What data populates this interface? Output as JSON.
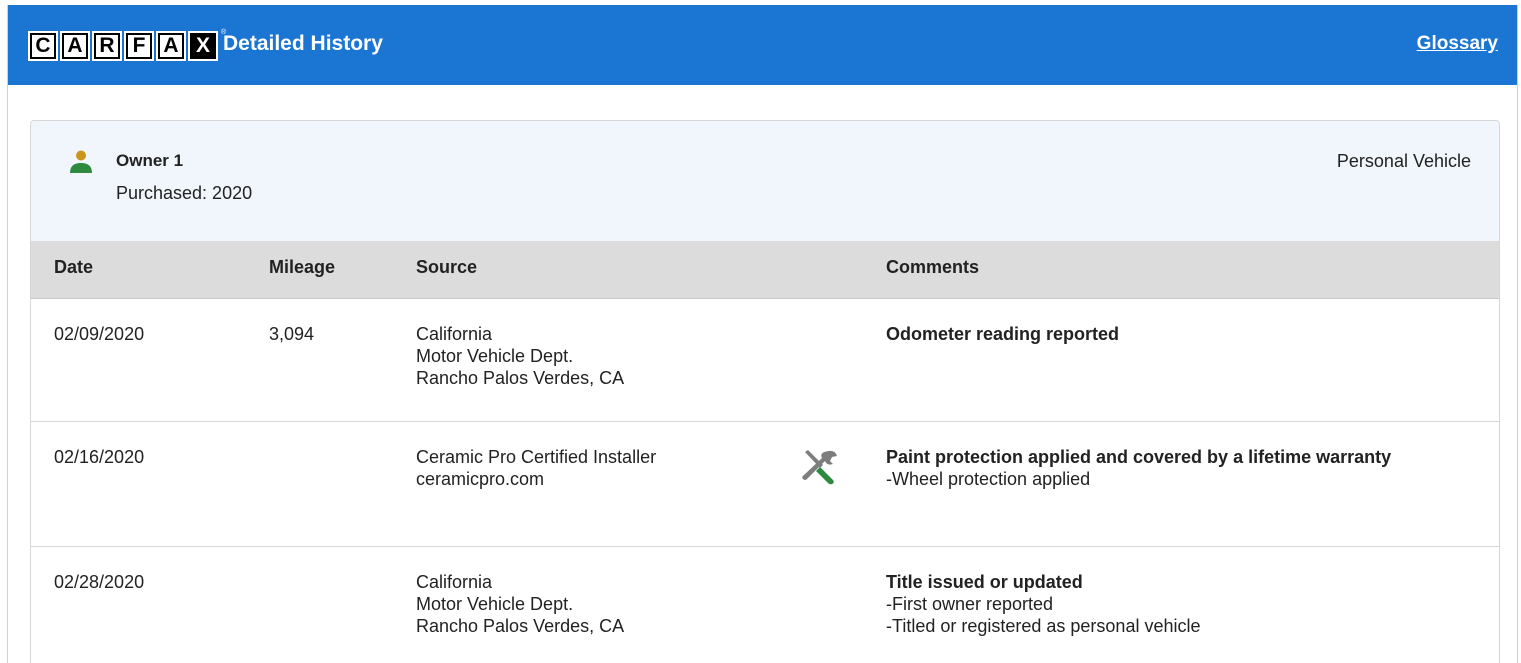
{
  "header": {
    "logo_letters": [
      "C",
      "A",
      "R",
      "F",
      "A",
      "X"
    ],
    "logo_registered": "®",
    "title": "Detailed History",
    "glossary_link": "Glossary",
    "bg_color": "#1b75d3"
  },
  "owner": {
    "icon": "person-icon",
    "name": "Owner 1",
    "purchased": "Purchased: 2020",
    "vehicle_type": "Personal Vehicle"
  },
  "table": {
    "columns": [
      "Date",
      "Mileage",
      "Source",
      "Comments"
    ],
    "rows": [
      {
        "date": "02/09/2020",
        "mileage": "3,094",
        "source": [
          "California",
          "Motor Vehicle Dept.",
          "Rancho Palos Verdes, CA"
        ],
        "comment_title": "Odometer reading reported",
        "comment_lines": []
      },
      {
        "date": "02/16/2020",
        "mileage": "",
        "source": [
          "Ceramic Pro Certified Installer",
          "ceramicpro.com"
        ],
        "source_icon": "tools-icon",
        "comment_title": "Paint protection applied and covered by a lifetime warranty",
        "comment_lines": [
          "-Wheel protection applied"
        ]
      },
      {
        "date": "02/28/2020",
        "mileage": "",
        "source": [
          "California",
          "Motor Vehicle Dept.",
          "Rancho Palos Verdes, CA"
        ],
        "comment_title": "Title issued or updated",
        "comment_lines": [
          "-First owner reported",
          "-Titled or registered as personal vehicle"
        ]
      }
    ]
  }
}
